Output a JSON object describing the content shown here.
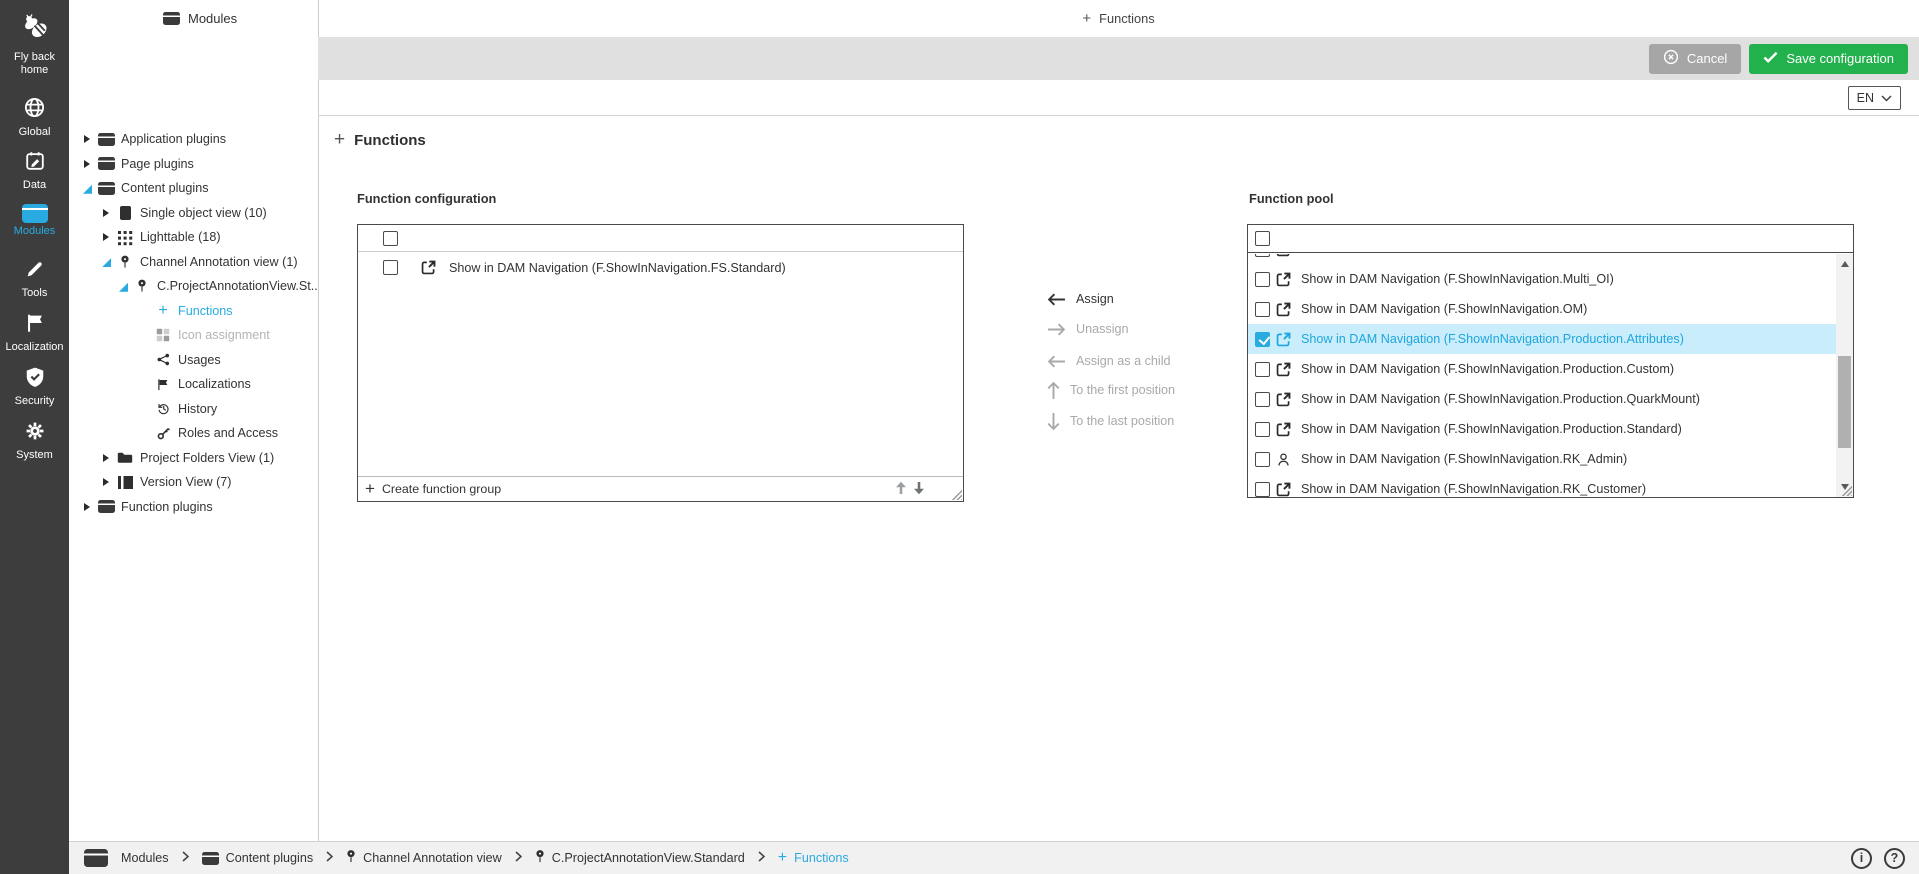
{
  "topbar": {
    "left_section_title": "Modules",
    "center_tab": "Functions",
    "cancel_button": "Cancel",
    "save_button": "Save configuration",
    "language_selector": "EN"
  },
  "sidebar": {
    "items": [
      {
        "label": "Fly back home",
        "icon": "bee-logo",
        "active": false
      },
      {
        "label": "Global",
        "icon": "globe",
        "active": false
      },
      {
        "label": "Data",
        "icon": "data-calendar",
        "active": false
      },
      {
        "label": "Modules",
        "icon": "modules-box",
        "active": true
      },
      {
        "label": "Tools",
        "icon": "pencil",
        "active": false
      },
      {
        "label": "Localization",
        "icon": "flag",
        "active": false
      },
      {
        "label": "Security",
        "icon": "shield-check",
        "active": false
      },
      {
        "label": "System",
        "icon": "gear",
        "active": false
      }
    ]
  },
  "tree": {
    "items": [
      {
        "label": "Application plugins",
        "level": 0,
        "state": "collapsed",
        "icon": "module"
      },
      {
        "label": "Page plugins",
        "level": 0,
        "state": "collapsed",
        "icon": "module"
      },
      {
        "label": "Content plugins",
        "level": 0,
        "state": "expanded",
        "icon": "module"
      },
      {
        "label": "Single object view (10)",
        "level": 1,
        "state": "collapsed",
        "icon": "single-object"
      },
      {
        "label": "Lighttable (18)",
        "level": 1,
        "state": "collapsed",
        "icon": "lighttable-grid"
      },
      {
        "label": "Channel Annotation view (1)",
        "level": 1,
        "state": "expanded",
        "icon": "pin"
      },
      {
        "label": "C.ProjectAnnotationView.St...",
        "level": 2,
        "state": "expanded",
        "icon": "pin"
      },
      {
        "label": "Functions",
        "level": 3,
        "icon": "plus",
        "selected": true
      },
      {
        "label": "Icon assignment",
        "level": 3,
        "icon": "icon-grid",
        "disabled": true
      },
      {
        "label": "Usages",
        "level": 3,
        "icon": "share"
      },
      {
        "label": "Localizations",
        "level": 3,
        "icon": "flag"
      },
      {
        "label": "History",
        "level": 3,
        "icon": "history"
      },
      {
        "label": "Roles and Access",
        "level": 3,
        "icon": "key"
      },
      {
        "label": "Project Folders View (1)",
        "level": 1,
        "state": "collapsed",
        "icon": "folder"
      },
      {
        "label": "Version View (7)",
        "level": 1,
        "state": "collapsed",
        "icon": "version"
      },
      {
        "label": "Function plugins",
        "level": 0,
        "state": "collapsed",
        "icon": "module"
      }
    ]
  },
  "main": {
    "heading": "Functions",
    "function_configuration": {
      "title": "Function configuration",
      "items": [
        {
          "label": "Show in DAM Navigation (F.ShowInNavigation.FS.Standard)",
          "icon": "export",
          "checked": false
        }
      ],
      "footer_action": "Create function group"
    },
    "actions": [
      {
        "label": "Assign",
        "icon": "arrow-left",
        "enabled": true
      },
      {
        "label": "Unassign",
        "icon": "arrow-right",
        "enabled": false
      },
      {
        "label": "Assign as a child",
        "icon": "arrow-left",
        "enabled": false
      },
      {
        "label": "To the first position",
        "icon": "arrow-up",
        "enabled": false
      },
      {
        "label": "To the last position",
        "icon": "arrow-down",
        "enabled": false
      }
    ],
    "function_pool": {
      "title": "Function pool",
      "items": [
        {
          "label": "Show in DAM Navigation (F.ShowInNavigation.Multi_OI)",
          "icon": "export",
          "checked": false
        },
        {
          "label": "Show in DAM Navigation (F.ShowInNavigation.OM)",
          "icon": "export",
          "checked": false
        },
        {
          "label": "Show in DAM Navigation (F.ShowInNavigation.Production.Attributes)",
          "icon": "export",
          "checked": true,
          "selected": true
        },
        {
          "label": "Show in DAM Navigation (F.ShowInNavigation.Production.Custom)",
          "icon": "export",
          "checked": false
        },
        {
          "label": "Show in DAM Navigation (F.ShowInNavigation.Production.QuarkMount)",
          "icon": "export",
          "checked": false
        },
        {
          "label": "Show in DAM Navigation (F.ShowInNavigation.Production.Standard)",
          "icon": "export",
          "checked": false
        },
        {
          "label": "Show in DAM Navigation (F.ShowInNavigation.RK_Admin)",
          "icon": "person",
          "checked": false
        },
        {
          "label": "Show in DAM Navigation (F.ShowInNavigation.RK_Customer)",
          "icon": "export",
          "checked": false
        }
      ]
    }
  },
  "breadcrumb": {
    "items": [
      {
        "label": "Modules",
        "icon": "module"
      },
      {
        "label": "Content plugins",
        "icon": "module"
      },
      {
        "label": "Channel Annotation view",
        "icon": "pin"
      },
      {
        "label": "C.ProjectAnnotationView.Standard",
        "icon": "pin"
      },
      {
        "label": "Functions",
        "icon": "plus",
        "active": true
      }
    ]
  },
  "footer_icons": {
    "info": "i",
    "help": "?"
  },
  "colors": {
    "accent": "#29abe2",
    "save_green": "#22b14c",
    "cancel_gray": "#a6a6a6",
    "selected_row_bg": "#c9edfb",
    "sidebar_bg": "#3d3d3d",
    "topbar_gray": "#e0e0e0"
  }
}
